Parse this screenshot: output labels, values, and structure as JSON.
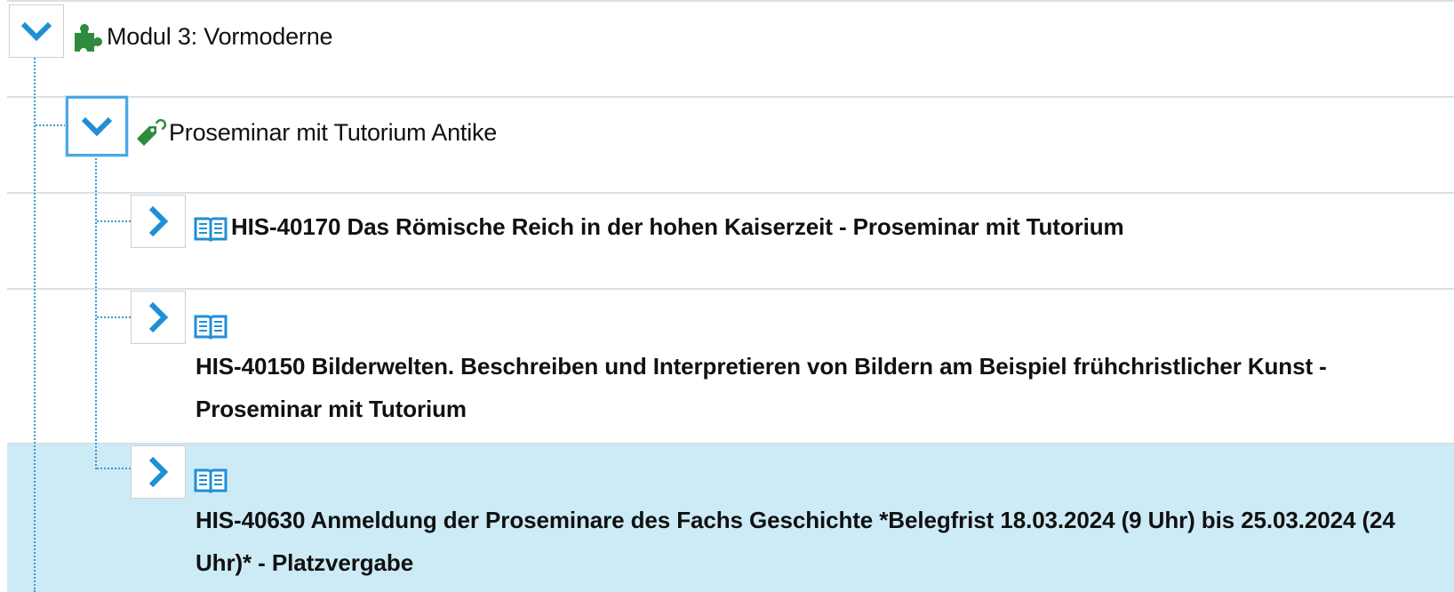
{
  "tree": {
    "module": {
      "label": "Modul 3: Vormoderne",
      "icon": "puzzle-icon",
      "expanded": true
    },
    "group": {
      "label": "Proseminar mit Tutorium Antike",
      "icon": "tag-link-icon",
      "expanded": true
    },
    "courses": [
      {
        "label": "HIS-40170 Das Römische Reich in der hohen Kaiserzeit - Proseminar mit Tutorium",
        "icon": "book-icon",
        "expanded": false
      },
      {
        "label": "HIS-40150 Bilderwelten. Beschreiben und Interpretieren von Bildern am Beispiel frühchristlicher Kunst - Proseminar mit Tutorium",
        "icon": "book-icon",
        "expanded": false
      },
      {
        "label": "HIS-40630 Anmeldung der Proseminare des Fachs Geschichte *Belegfrist 18.03.2024 (9 Uhr) bis 25.03.2024 (24 Uhr)* - Platzvergabe",
        "icon": "book-icon",
        "expanded": false,
        "selected": true
      }
    ]
  },
  "colors": {
    "accent": "#1f8fd6",
    "puzzle": "#2e8b3e",
    "selected_row": "#cdebf7",
    "border": "#d7e1e8"
  }
}
